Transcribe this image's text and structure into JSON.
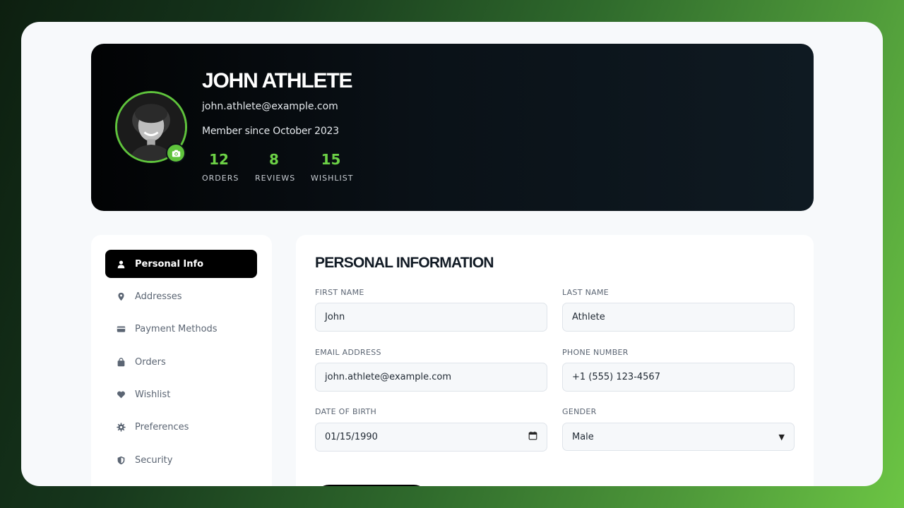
{
  "profile": {
    "name": "JOHN ATHLETE",
    "email": "john.athlete@example.com",
    "member_since": "Member since October 2023",
    "stats": [
      {
        "value": "12",
        "label": "ORDERS"
      },
      {
        "value": "8",
        "label": "REVIEWS"
      },
      {
        "value": "15",
        "label": "WISHLIST"
      }
    ]
  },
  "sidebar": {
    "items": [
      {
        "label": "Personal Info",
        "icon": "user-icon",
        "active": true
      },
      {
        "label": "Addresses",
        "icon": "map-pin-icon"
      },
      {
        "label": "Payment Methods",
        "icon": "credit-card-icon"
      },
      {
        "label": "Orders",
        "icon": "shopping-bag-icon"
      },
      {
        "label": "Wishlist",
        "icon": "heart-icon"
      },
      {
        "label": "Preferences",
        "icon": "gear-icon"
      },
      {
        "label": "Security",
        "icon": "shield-icon"
      }
    ]
  },
  "form": {
    "title": "PERSONAL INFORMATION",
    "first_name": {
      "label": "FIRST NAME",
      "value": "John"
    },
    "last_name": {
      "label": "LAST NAME",
      "value": "Athlete"
    },
    "email": {
      "label": "EMAIL ADDRESS",
      "value": "john.athlete@example.com"
    },
    "phone": {
      "label": "PHONE NUMBER",
      "value": "+1 (555) 123-4567"
    },
    "dob": {
      "label": "DATE OF BIRTH",
      "value": "01/15/1990"
    },
    "gender": {
      "label": "GENDER",
      "value": "Male"
    }
  },
  "colors": {
    "accent": "#5fc33c",
    "hero_bg": "#0a1117",
    "active_nav": "#000000"
  }
}
